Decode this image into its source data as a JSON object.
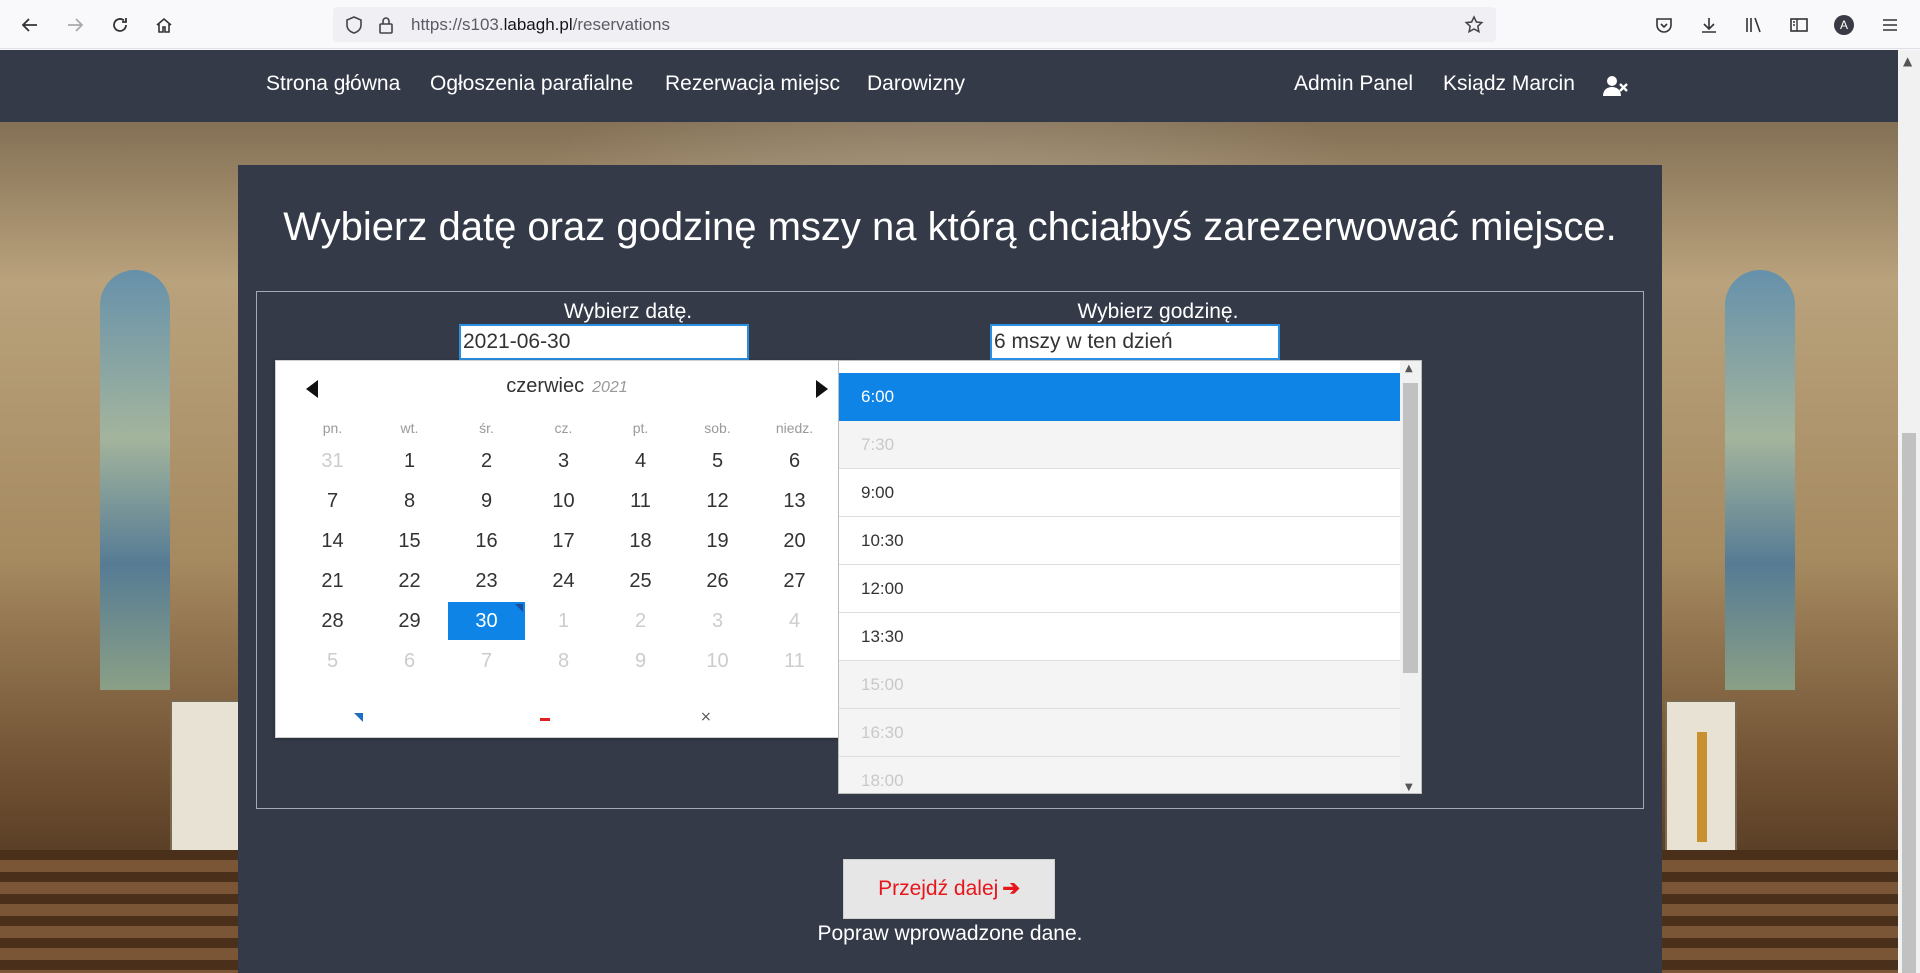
{
  "browser": {
    "url_prefix": "https://s103.",
    "url_domain": "labagh.pl",
    "url_path": "/reservations",
    "account_initial": "A"
  },
  "nav": {
    "links": [
      "Strona główna",
      "Ogłoszenia parafialne",
      "Rezerwacja miejsc",
      "Darowizny"
    ],
    "admin": "Admin Panel",
    "user": "Ksiądz Marcin",
    "logout_icon": "user-times-icon"
  },
  "main": {
    "heading": "Wybierz datę oraz godzinę mszy na którą chciałbyś zarezerwować miejsce.",
    "date_label": "Wybierz datę.",
    "date_value": "2021-06-30",
    "time_label": "Wybierz godzinę.",
    "time_value": "6 mszy w ten dzień",
    "next_button": "Przejdź dalej",
    "error": "Popraw wprowadzone dane."
  },
  "calendar": {
    "month": "czerwiec",
    "year": "2021",
    "weekdays": [
      "pn.",
      "wt.",
      "śr.",
      "cz.",
      "pt.",
      "sob.",
      "niedz."
    ],
    "weeks": [
      [
        "31",
        "1",
        "2",
        "3",
        "4",
        "5",
        "6"
      ],
      [
        "7",
        "8",
        "9",
        "10",
        "11",
        "12",
        "13"
      ],
      [
        "14",
        "15",
        "16",
        "17",
        "18",
        "19",
        "20"
      ],
      [
        "21",
        "22",
        "23",
        "24",
        "25",
        "26",
        "27"
      ],
      [
        "28",
        "29",
        "30",
        "1",
        "2",
        "3",
        "4"
      ],
      [
        "5",
        "6",
        "7",
        "8",
        "9",
        "10",
        "11"
      ]
    ],
    "selected_day": "30",
    "foot_close": "×"
  },
  "times": [
    {
      "label": "6:00",
      "state": "active"
    },
    {
      "label": "7:30",
      "state": "disabled"
    },
    {
      "label": "9:00",
      "state": "enabled"
    },
    {
      "label": "10:30",
      "state": "enabled"
    },
    {
      "label": "12:00",
      "state": "enabled"
    },
    {
      "label": "13:30",
      "state": "enabled"
    },
    {
      "label": "15:00",
      "state": "disabled"
    },
    {
      "label": "16:30",
      "state": "disabled"
    },
    {
      "label": "18:00",
      "state": "disabled"
    }
  ],
  "colors": {
    "navbar": "#343a48",
    "accent": "#0d84e6",
    "next_button_text": "#e8151b"
  }
}
